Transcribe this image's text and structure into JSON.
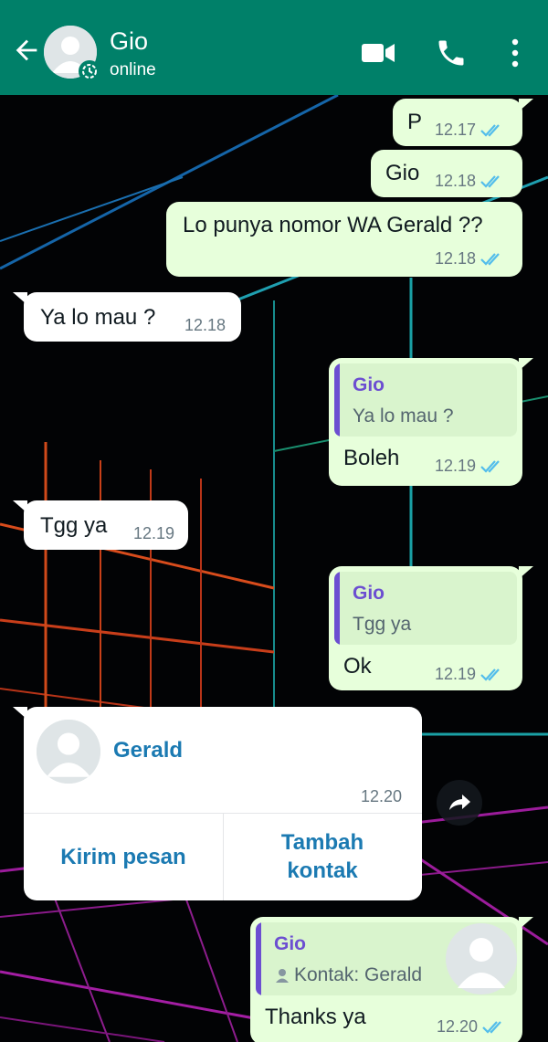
{
  "header": {
    "contact_name": "Gio",
    "status": "online",
    "color": "#008069"
  },
  "messages": [
    {
      "direction": "out",
      "text": "P",
      "time": "12.17",
      "read": true
    },
    {
      "direction": "out",
      "text": "Gio",
      "time": "12.18",
      "read": true
    },
    {
      "direction": "out",
      "text": "Lo punya nomor WA Gerald ??",
      "time": "12.18",
      "read": true
    },
    {
      "direction": "in",
      "text": "Ya lo mau ?",
      "time": "12.18"
    },
    {
      "direction": "out",
      "quote": {
        "name": "Gio",
        "text": "Ya lo mau ?"
      },
      "text": "Boleh",
      "time": "12.19",
      "read": true
    },
    {
      "direction": "in",
      "text": "Tgg ya",
      "time": "12.19"
    },
    {
      "direction": "out",
      "quote": {
        "name": "Gio",
        "text": "Tgg ya"
      },
      "text": "Ok",
      "time": "12.19",
      "read": true
    },
    {
      "direction": "in",
      "type": "contact",
      "contact_name": "Gerald",
      "time": "12.20",
      "actions": [
        "Kirim pesan",
        "Tambah kontak"
      ]
    },
    {
      "direction": "out",
      "quote": {
        "name": "Gio",
        "text": "Kontak: Gerald"
      },
      "text": "Thanks ya",
      "time": "12.20",
      "read": true
    }
  ],
  "colors": {
    "outgoing_bubble": "#e7ffdb",
    "incoming_bubble": "#ffffff",
    "quote_accent": "#6c4ed1",
    "link_blue": "#1b7ab2",
    "read_tick": "#53bdeb"
  },
  "icons": [
    "back-arrow-icon",
    "avatar-icon",
    "status-ring-icon",
    "video-call-icon",
    "voice-call-icon",
    "more-menu-icon",
    "double-tick-icon",
    "forward-icon",
    "person-icon"
  ]
}
